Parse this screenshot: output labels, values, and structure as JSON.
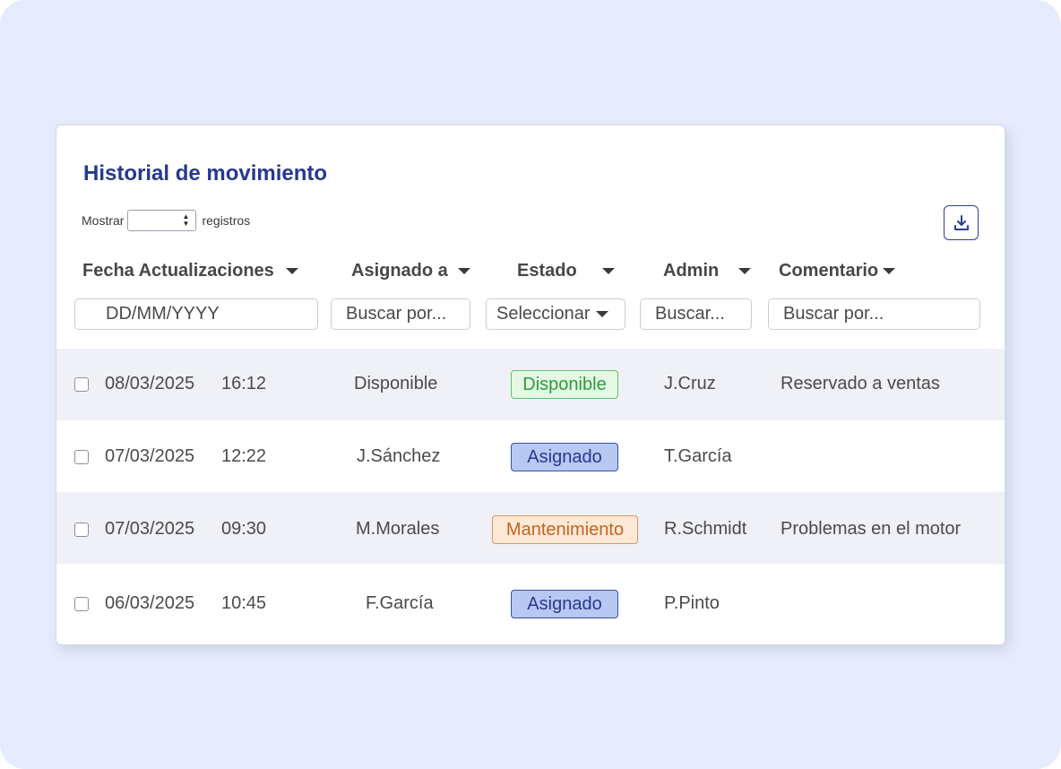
{
  "title": "Historial de movimiento",
  "show": {
    "prefix": "Mostrar",
    "suffix": "registros"
  },
  "download": {
    "icon": "download-icon"
  },
  "columns": [
    {
      "label": "Fecha Actualizaciones"
    },
    {
      "label": "Asignado a"
    },
    {
      "label": "Estado"
    },
    {
      "label": "Admin"
    },
    {
      "label": "Comentario"
    }
  ],
  "filters": {
    "date_placeholder": "DD/MM/YYYY",
    "assigned_placeholder": "Buscar por...",
    "status_selected": "Seleccionar",
    "admin_placeholder": "Buscar...",
    "comment_placeholder": "Buscar por..."
  },
  "rows": [
    {
      "date": "08/03/2025",
      "time": "16:12",
      "assigned": "Disponible",
      "status": "Disponible",
      "admin": "J.Cruz",
      "comment": "Reservado a ventas"
    },
    {
      "date": "07/03/2025",
      "time": "12:22",
      "assigned": "J.Sánchez",
      "status": "Asignado",
      "admin": "T.García",
      "comment": ""
    },
    {
      "date": "07/03/2025",
      "time": "09:30",
      "assigned": "M.Morales",
      "status": "Mantenimiento",
      "admin": "R.Schmidt",
      "comment": "Problemas en el motor"
    },
    {
      "date": "06/03/2025",
      "time": "10:45",
      "assigned": "F.García",
      "status": "Asignado",
      "admin": "P.Pinto",
      "comment": ""
    }
  ],
  "colors": {
    "title": "#26398f",
    "background": "#e6ecfd",
    "row_alt": "#eff1f6",
    "status_disponible": "#2e9a3a",
    "status_asignado": "#26398f",
    "status_mantenimiento": "#c2651f"
  }
}
